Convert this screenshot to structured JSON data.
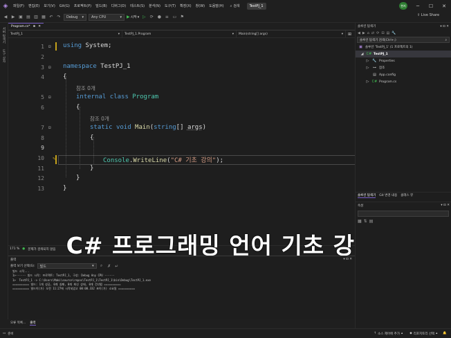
{
  "menubar": {
    "items": [
      "파일(F)",
      "편집(E)",
      "보기(V)",
      "Git(G)",
      "프로젝트(P)",
      "빌드(B)",
      "디버그(D)",
      "테스트(S)",
      "분석(N)",
      "도구(T)",
      "확장(X)",
      "창(W)",
      "도움말(H)"
    ],
    "search_label": "검색",
    "solution_name": "TestPJ_1",
    "avatar": "현지"
  },
  "toolbar": {
    "config": "Debug",
    "platform": "Any CPU",
    "start_label": "시작",
    "live_share": "Live Share"
  },
  "left_tabs": [
    "서버 탐색기",
    "도구 상자",
    "데이터 소스"
  ],
  "editor": {
    "tab_label": "Program.cs*",
    "nav": [
      "TestPJ_1",
      "TestPJ_1.Program",
      "Main(string[] args)"
    ],
    "line_numbers": [
      "1",
      "2",
      "3",
      "4",
      "5",
      "6",
      "7",
      "8",
      "9",
      "10",
      "11",
      "12",
      "13"
    ],
    "lens_label": "참조 0개",
    "kw_using": "using",
    "ns_system": "System",
    "kw_namespace": "namespace",
    "ns_name": "TestPJ_1",
    "kw_internal": "internal",
    "kw_class": "class",
    "class_name": "Program",
    "kw_static": "static",
    "kw_void": "void",
    "method_name": "Main",
    "kw_string": "string",
    "param_name": "args",
    "console_type": "Console",
    "writeline": "WriteLine",
    "string_literal": "\"C# 기초 강의\"",
    "zoom": "171 %",
    "status_info": "문제가 검색되지 않음"
  },
  "overlay_title": "C# 프로그래밍 언어 기초 강의",
  "output": {
    "title": "출력",
    "source_label": "출력 보기 선택(S):",
    "source_value": "빌드",
    "lines": [
      "빌드 시작...",
      "1>------ 빌드 시작: 프로젝트: TestPJ_1, 구성: Debug Any CPU ------",
      "1>  TestPJ_1 -> C:\\Users\\Maki\\source\\repos\\TestPJ_1\\TestPJ_1\\bin\\Debug\\TestPJ_1.exe",
      "========== 빌드: 1개 성공, 0개 실패, 0개 최신 상태, 0개 건너뜀 ==========",
      "========== 빌드이(가) 오전 11:27에 시작되었고 00:00.332 초이(가) 소요됨 =========="
    ],
    "tabs": [
      "오류 목록...",
      "출력"
    ]
  },
  "status": {
    "left": "준비",
    "source_control": "소스 제어에 추가",
    "repo": "리포지토리 선택"
  },
  "solution_explorer": {
    "title": "솔루션 탐색기",
    "search_placeholder": "솔루션 탐색기 검색(Ctrl+;)",
    "solution_label": "솔루션 'TestPJ_1' (1 프로젝트의 1)",
    "project": "TestPJ_1",
    "items": [
      "Properties",
      "참조",
      "App.config",
      "Program.cs"
    ],
    "tabs": [
      "솔루션 탐색기",
      "Git 변경 내용",
      "클래스 뷰"
    ]
  },
  "properties": {
    "title": "속성"
  },
  "colors": {
    "accent": "#7a5fc7",
    "keyword": "#569cd6",
    "type": "#4ec9b0",
    "method": "#dcdcaa",
    "string": "#d69d85",
    "change_marker": "#c5a21a"
  }
}
